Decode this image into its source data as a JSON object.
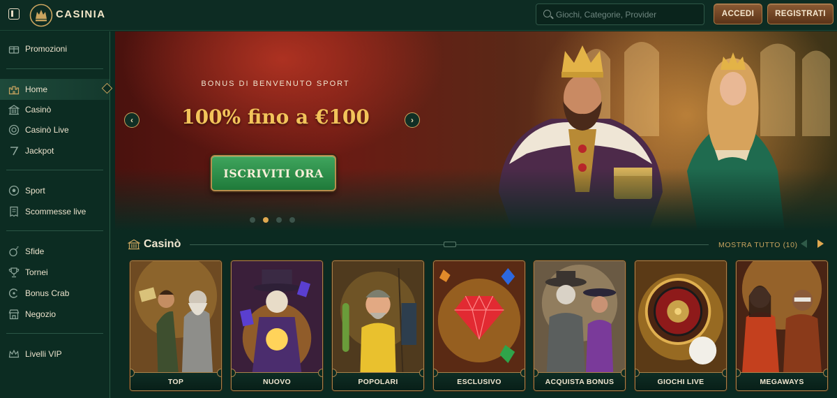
{
  "brand": {
    "name": "CASINIA"
  },
  "header": {
    "search_placeholder": "Giochi, Categorie, Provider",
    "login_label": "ACCEDI",
    "register_label": "REGISTRATI"
  },
  "sidebar": {
    "items": [
      {
        "label": "Promozioni",
        "icon": "gift-box-icon"
      },
      {
        "label": "Home",
        "icon": "castle-icon",
        "active": true
      },
      {
        "label": "Casinò",
        "icon": "casino-building-icon"
      },
      {
        "label": "Casinò Live",
        "icon": "poker-chip-icon"
      },
      {
        "label": "Jackpot",
        "icon": "slot-seven-icon"
      },
      {
        "label": "Sport",
        "icon": "soccer-ball-icon"
      },
      {
        "label": "Scommesse live",
        "icon": "live-bet-ticket-icon"
      },
      {
        "label": "Sfide",
        "icon": "challenge-bomb-icon"
      },
      {
        "label": "Tornei",
        "icon": "trophy-icon"
      },
      {
        "label": "Bonus Crab",
        "icon": "crab-claw-icon"
      },
      {
        "label": "Negozio",
        "icon": "shop-icon"
      },
      {
        "label": "Livelli VIP",
        "icon": "crown-icon"
      }
    ]
  },
  "hero": {
    "kicker": "BONUS DI BENVENUTO SPORT",
    "title": "100% fino a €100",
    "cta_label": "ISCRIVITI ORA",
    "slides_total": 4,
    "active_slide": 2
  },
  "casino_section": {
    "title": "Casinò",
    "show_all_label": "MOSTRA TUTTO (10)",
    "tiles": [
      {
        "label": "TOP"
      },
      {
        "label": "NUOVO"
      },
      {
        "label": "POPOLARI"
      },
      {
        "label": "ESCLUSIVO"
      },
      {
        "label": "ACQUISTA BONUS"
      },
      {
        "label": "GIOCHI LIVE"
      },
      {
        "label": "MEGAWAYS"
      }
    ]
  },
  "colors": {
    "background": "#0b2a21",
    "gold_accent": "#c9a45f",
    "hero_title": "#f2c45a",
    "cta_green": "#2e8f4b",
    "button_brown": "#6e4425"
  }
}
